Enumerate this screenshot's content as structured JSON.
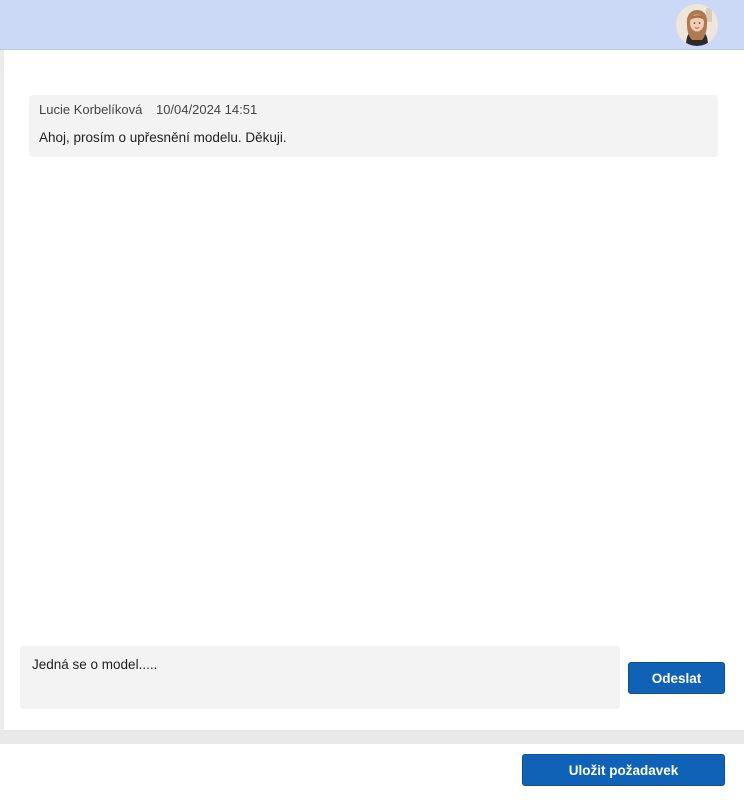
{
  "header": {
    "avatar_icon": "user-avatar-photo"
  },
  "messages": [
    {
      "author": "Lucie Korbelíková",
      "timestamp": "10/04/2024 14:51",
      "text": "Ahoj, prosím o upřesnění modelu. Děkuji."
    }
  ],
  "composer": {
    "value": "Jedná se o model.....",
    "send_label": "Odeslat"
  },
  "footer": {
    "save_label": "Uložit požadavek"
  },
  "colors": {
    "header_bg": "#cbd9f7",
    "primary_button": "#0f62b6",
    "message_bg": "#f3f3f3"
  }
}
